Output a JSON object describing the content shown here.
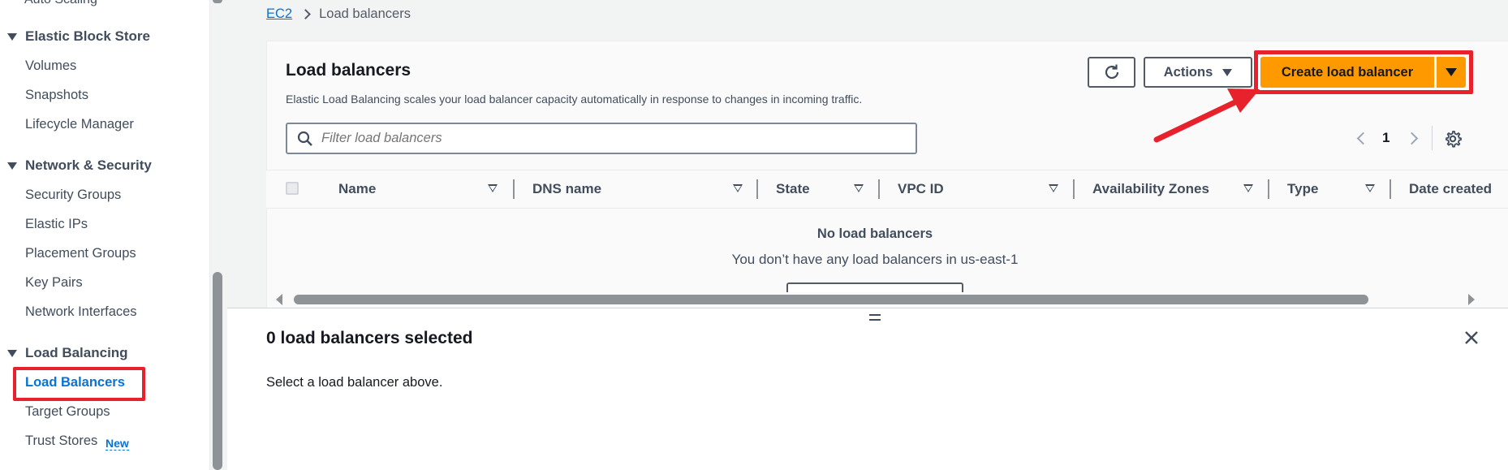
{
  "sidebar": {
    "clipped_item": "Auto Scaling",
    "sections": [
      {
        "title": "Elastic Block Store",
        "items": [
          "Volumes",
          "Snapshots",
          "Lifecycle Manager"
        ]
      },
      {
        "title": "Network & Security",
        "items": [
          "Security Groups",
          "Elastic IPs",
          "Placement Groups",
          "Key Pairs",
          "Network Interfaces"
        ]
      },
      {
        "title": "Load Balancing",
        "items": [
          "Load Balancers",
          "Target Groups",
          "Trust Stores"
        ]
      }
    ],
    "new_badge": "New",
    "active_item": "Load Balancers"
  },
  "breadcrumb": {
    "root": "EC2",
    "current": "Load balancers"
  },
  "panel": {
    "title": "Load balancers",
    "description": "Elastic Load Balancing scales your load balancer capacity automatically in response to changes in incoming traffic.",
    "actions_label": "Actions",
    "create_label": "Create load balancer",
    "search_placeholder": "Filter load balancers",
    "page": "1"
  },
  "table": {
    "columns": [
      "Name",
      "DNS name",
      "State",
      "VPC ID",
      "Availability Zones",
      "Type",
      "Date created"
    ],
    "empty_title": "No load balancers",
    "empty_subtitle": "You don’t have any load balancers in us-east-1"
  },
  "split_panel": {
    "title": "0 load balancers selected",
    "text": "Select a load balancer above."
  },
  "colors": {
    "accent_orange": "#ff9900",
    "link_blue": "#0972d3",
    "highlight_red": "#e8222c"
  }
}
